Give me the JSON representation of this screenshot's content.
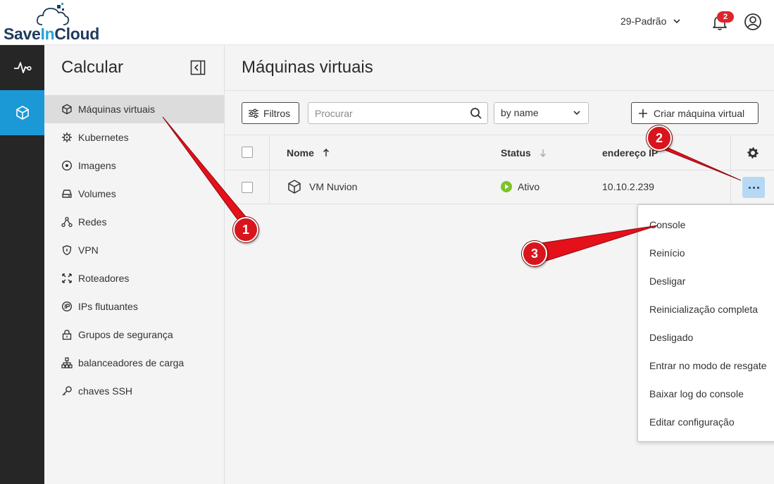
{
  "header": {
    "logo_prefix": "Save",
    "logo_highlight": "In",
    "logo_suffix": "Cloud",
    "project": "29-Padrão",
    "notifications_count": "2"
  },
  "rail": {
    "items": [
      {
        "icon": "activity-pulse-icon",
        "active": false
      },
      {
        "icon": "cube-icon",
        "active": true
      }
    ]
  },
  "sidebar": {
    "title": "Calcular",
    "items": [
      {
        "label": "Máquinas virtuais",
        "icon": "cube-icon",
        "active": true
      },
      {
        "label": "Kubernetes",
        "icon": "kubernetes-icon"
      },
      {
        "label": "Imagens",
        "icon": "disc-icon"
      },
      {
        "label": "Volumes",
        "icon": "drive-icon"
      },
      {
        "label": "Redes",
        "icon": "network-icon"
      },
      {
        "label": "VPN",
        "icon": "shield-icon"
      },
      {
        "label": "Roteadores",
        "icon": "router-icon"
      },
      {
        "label": "IPs flutuantes",
        "icon": "floating-ip-icon"
      },
      {
        "label": "Grupos de segurança",
        "icon": "lock-icon"
      },
      {
        "label": "balanceadores de carga",
        "icon": "load-balancer-icon"
      },
      {
        "label": "chaves SSH",
        "icon": "key-icon"
      }
    ]
  },
  "main": {
    "title": "Máquinas virtuais",
    "toolbar": {
      "filter_label": "Filtros",
      "search_placeholder": "Procurar",
      "sort_value": "by name",
      "create_label": "Criar máquina virtual"
    },
    "table": {
      "columns": {
        "name": "Nome",
        "status": "Status",
        "ip": "endereço IP"
      },
      "rows": [
        {
          "name": "VM Nuvion",
          "status": "Ativo",
          "ip": "10.10.2.239"
        }
      ]
    },
    "row_menu": {
      "items": [
        "Console",
        "Reinício",
        "Desligar",
        "Reinicialização completa",
        "Desligado",
        "Entrar no modo de resgate",
        "Baixar log do console",
        "Editar configuração"
      ]
    }
  },
  "annotations": {
    "markers": [
      "1",
      "2",
      "3"
    ],
    "color": "#d8141c"
  },
  "colors": {
    "accent": "#1a99d6",
    "status_active": "#7cc42a",
    "badge": "#e0242b",
    "kebab_active": "#b6d8f5"
  }
}
